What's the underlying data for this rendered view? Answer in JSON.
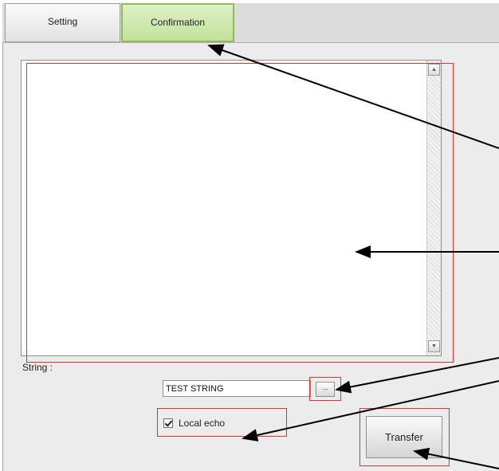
{
  "tabs": [
    {
      "label": "Setting"
    },
    {
      "label": "Confirmation"
    }
  ],
  "form": {
    "string_label": "String :",
    "string_value": "TEST STRING",
    "browse_label": "...",
    "local_echo_label": "Local echo",
    "local_echo_checked": true,
    "transfer_label": "Transfer"
  },
  "colors": {
    "highlight": "#e03030",
    "active_tab": "#c3e19b"
  }
}
